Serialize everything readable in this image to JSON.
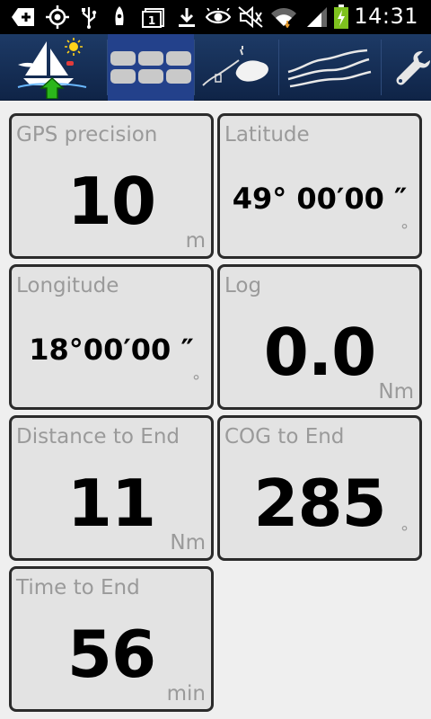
{
  "status_bar": {
    "time": "14:31",
    "icons": [
      "add-box-icon",
      "gps-target-icon",
      "usb-icon",
      "boat-notification-icon",
      "calendar-icon",
      "download-icon",
      "eye-icon",
      "mute-icon",
      "wifi-icon",
      "signal-icon",
      "battery-charging-icon"
    ]
  },
  "toolbar": {
    "items": [
      {
        "name": "app-logo",
        "icon": "sailboat-icon"
      },
      {
        "name": "dashboard-tab",
        "icon": "grid-icon",
        "active": true
      },
      {
        "name": "map-tab",
        "icon": "map-route-icon"
      },
      {
        "name": "track-tab",
        "icon": "waves-icon"
      },
      {
        "name": "settings-tab",
        "icon": "wrench-icon"
      }
    ]
  },
  "tiles": [
    {
      "label": "GPS precision",
      "value": "10",
      "unit": "m"
    },
    {
      "label": "Latitude",
      "value": "49° 00′00 ″",
      "unit": "°"
    },
    {
      "label": "Longitude",
      "value": "18°00′00 ″",
      "unit": "°"
    },
    {
      "label": "Log",
      "value": "0.0",
      "unit": "Nm"
    },
    {
      "label": "Distance to End",
      "value": "11",
      "unit": "Nm"
    },
    {
      "label": "COG to End",
      "value": "285",
      "unit": "°"
    },
    {
      "label": "Time to End",
      "value": "56",
      "unit": "min"
    }
  ],
  "colors": {
    "toolbar_bg": "#12294f",
    "toolbar_active": "#23418b",
    "tile_bg": "#e3e3e3",
    "tile_border": "#2b2b2b",
    "label_gray": "#9a9a9a"
  }
}
